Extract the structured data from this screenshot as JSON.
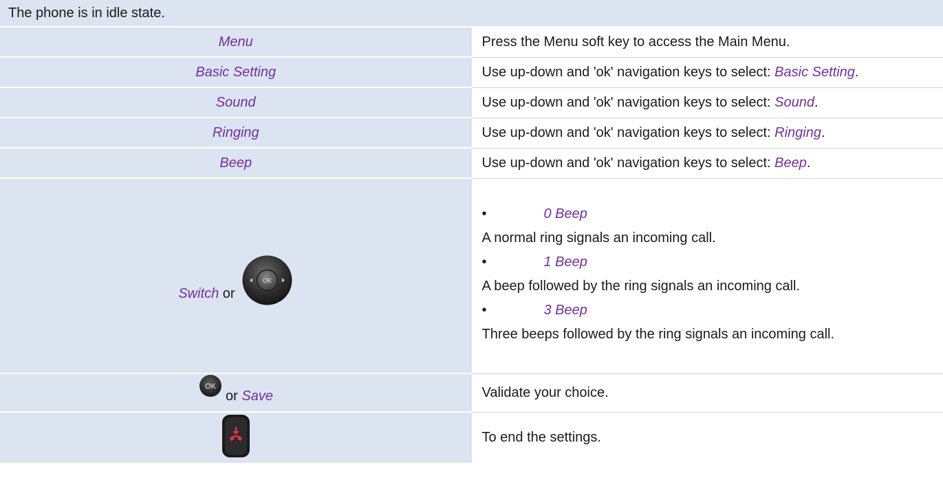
{
  "header": {
    "text": "The phone is in idle state."
  },
  "rows": [
    {
      "key": "Menu",
      "desc": "Press the Menu soft key to access the Main Menu."
    },
    {
      "key": "Basic Setting",
      "desc_prefix": "Use up-down and 'ok' navigation keys to select: ",
      "desc_em": "Basic Setting",
      "desc_suffix": "."
    },
    {
      "key": "Sound",
      "desc_prefix": "Use up-down and 'ok' navigation keys to select: ",
      "desc_em": "Sound",
      "desc_suffix": "."
    },
    {
      "key": "Ringing",
      "desc_prefix": "Use up-down and 'ok' navigation keys to select: ",
      "desc_em": "Ringing",
      "desc_suffix": "."
    },
    {
      "key": "Beep",
      "desc_prefix": "Use up-down and 'ok' navigation keys to select: ",
      "desc_em": "Beep",
      "desc_suffix": "."
    }
  ],
  "switch_row": {
    "key_em": "Switch",
    "key_or": " or ",
    "icon": "nav-pad-icon",
    "options": [
      {
        "bullet": "•",
        "label": "0 Beep",
        "desc": "A normal ring signals an incoming call."
      },
      {
        "bullet": "•",
        "label": "1 Beep",
        "desc": "A beep followed by the ring signals an incoming call."
      },
      {
        "bullet": "•",
        "label": "3 Beep",
        "desc": "Three beeps followed by the ring signals an incoming call."
      }
    ]
  },
  "ok_row": {
    "icon": "ok-button-icon",
    "ok_label": "OK",
    "or": " or ",
    "key_em": "Save",
    "desc": "Validate your choice."
  },
  "end_row": {
    "icon": "hang-up-key-icon",
    "desc": "To end the settings."
  },
  "colors": {
    "key_bg": "#dbe4f0",
    "accent": "#7030a0",
    "hangup_red": "#e8304f"
  }
}
